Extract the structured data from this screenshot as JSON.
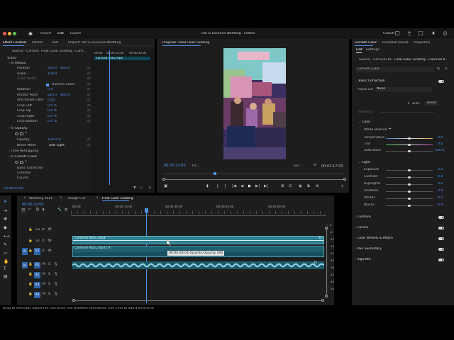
{
  "app": {
    "nav": [
      "Import",
      "Edit",
      "Export"
    ],
    "title": "Om & Laveena Wedding",
    "title_status": "Edited",
    "workspace": "COLOR"
  },
  "colors": {
    "accent": "#4f95f2",
    "track_clip": "#2f7f91",
    "audio_clip": "#1e5e6e"
  },
  "source_panel": {
    "tabs": [
      "Effect Controls",
      "Effects",
      "Text",
      "Project: Om & Laveena Wedding"
    ],
    "clip_selector": "Source · Carnival...",
    "sequence_selector": "Final Color Grading · Carn...",
    "ruler": [
      "00:00",
      "00:00:15:00",
      "00:00:30:00"
    ],
    "clip_bar": "Carnival REEL.mp4",
    "groups": {
      "video": "Video",
      "motion": "Motion",
      "opacity": "Opacity",
      "time_remap": "Time Remapping",
      "lumetri": "Lumetri Color"
    },
    "motion_props": [
      {
        "label": "Position",
        "v1": "540.0",
        "v2": "960.0"
      },
      {
        "label": "Scale",
        "v1": "100.0",
        "v2": ""
      },
      {
        "label": "Scale Width",
        "v1": "",
        "v2": ""
      },
      {
        "label": "Uniform Scale",
        "v1": "",
        "v2": ""
      },
      {
        "label": "Rotation",
        "v1": "0.0",
        "v2": ""
      },
      {
        "label": "Anchor Point",
        "v1": "540.0",
        "v2": "960.0"
      },
      {
        "label": "Anti-flicker Filter",
        "v1": "0.00",
        "v2": ""
      },
      {
        "label": "Crop Left",
        "v1": "0.0 %",
        "v2": ""
      },
      {
        "label": "Crop Top",
        "v1": "0.0 %",
        "v2": ""
      },
      {
        "label": "Crop Right",
        "v1": "0.0 %",
        "v2": ""
      },
      {
        "label": "Crop Bottom",
        "v1": "0.0 %",
        "v2": ""
      }
    ],
    "opacity_props": [
      {
        "label": "Opacity",
        "v1": "100.0 %"
      },
      {
        "label": "Blend Mode",
        "v1": "Soft Light"
      }
    ],
    "lumetri_props": [
      "Basic Correction",
      "Creative",
      "Curves"
    ],
    "timecode": "00:00:22:00"
  },
  "program": {
    "title": "Program: Final Color Grading",
    "timecode": "00:00:22:00",
    "fit": "Fit",
    "quality": "Full",
    "duration": "00:01:17:00"
  },
  "timeline": {
    "tabs": [
      "Wedding REEL",
      "Rough Cut",
      "Final Color Grading"
    ],
    "timecode": "00:00:22:00",
    "ruler": [
      "00:00",
      "00:00:15:00",
      "00:00:30:00",
      "00:00:45:00",
      "00:01:00:00"
    ],
    "video_tracks": [
      "V3",
      "V2",
      "V1"
    ],
    "audio_tracks": [
      "A1",
      "A2",
      "A3",
      "A4"
    ],
    "clip_v2": "Carnival REEL.mp4",
    "clip_v1": "Carnival REEL.mp4 [V]",
    "tooltip": "00:00:28:04  Opacity:Opacity  100",
    "meter_db": [
      "0",
      "-6",
      "-12",
      "-18",
      "-24",
      "-30",
      "-36",
      "-42",
      "-48",
      "-54"
    ]
  },
  "lumetri": {
    "tabs": [
      "Lumetri Color",
      "Essential Sound",
      "Properties"
    ],
    "edit_tabs": [
      "Edit",
      "Settings"
    ],
    "source_selector": "Source · Carnival RE...",
    "sequence_selector": "Final Color Grading · Carnival R...",
    "effect_selector": "Lumetri Color",
    "basic_correction": "Basic Correction",
    "input_lut_label": "Input LUT",
    "input_lut_value": "None",
    "intensity": "Intensity",
    "auto": "Auto",
    "reset": "Reset",
    "color_section": "Color",
    "white_balance": "White Balance",
    "color_sliders": [
      {
        "label": "Temperature",
        "value": "0.0",
        "pos": 0.5
      },
      {
        "label": "Tint",
        "value": "0.0",
        "pos": 0.5
      },
      {
        "label": "Saturation",
        "value": "100.0",
        "pos": 0.5
      }
    ],
    "light_section": "Light",
    "light_sliders": [
      {
        "label": "Exposure",
        "value": "0.0",
        "pos": 0.5
      },
      {
        "label": "Contrast",
        "value": "0.0",
        "pos": 0.5
      },
      {
        "label": "Highlights",
        "value": "0.0",
        "pos": 0.5
      },
      {
        "label": "Shadows",
        "value": "0.0",
        "pos": 0.5
      },
      {
        "label": "Whites",
        "value": "0.0",
        "pos": 0.5
      },
      {
        "label": "Blacks",
        "value": "0.0",
        "pos": 0.5
      }
    ],
    "collapsed_sections": [
      "Creative",
      "Curves",
      "Color Wheels & Match",
      "HSL Secondary",
      "Vignette"
    ]
  },
  "status_bar": "Drag to vertically adjust the connector line between keyframes. Use Cmd to add a keyframe."
}
